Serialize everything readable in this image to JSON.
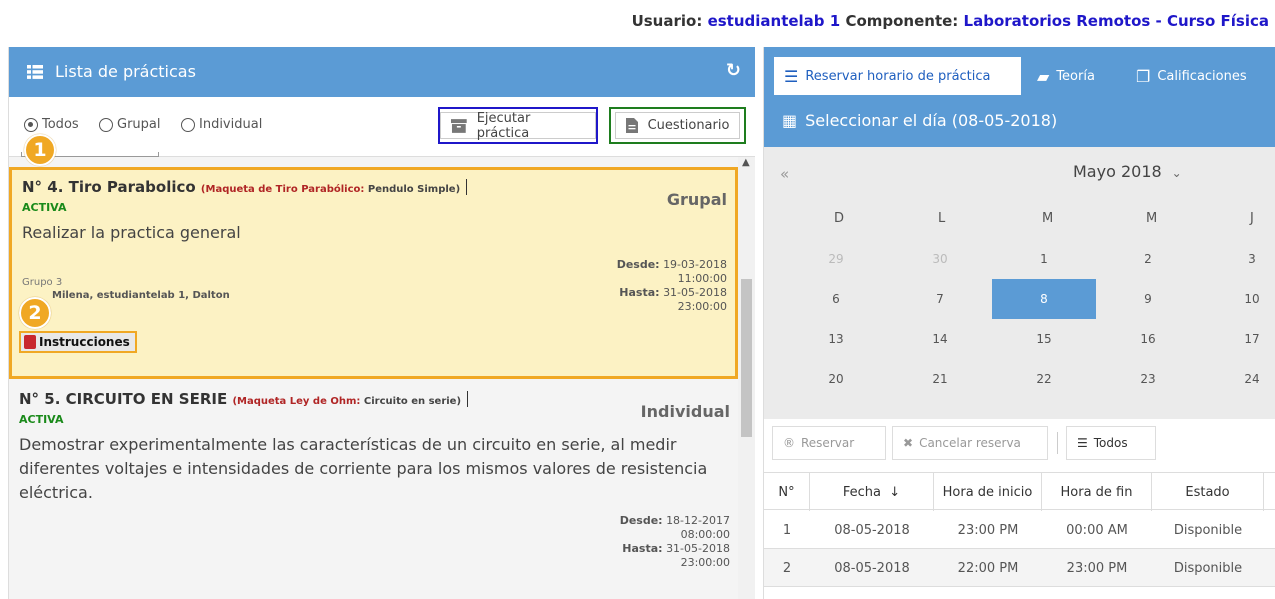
{
  "userbar": {
    "usuario_label": "Usuario:",
    "usuario": "estudiantelab 1",
    "componente_label": "Componente:",
    "componente": "Laboratorios Remotos - Curso Física"
  },
  "left": {
    "title": "Lista de prácticas",
    "filters": [
      "Todos",
      "Grupal",
      "Individual"
    ],
    "selected_filter": "Todos",
    "buttons": {
      "ejecutar": "Ejecutar práctica",
      "cuestionario": "Cuestionario"
    },
    "badges": [
      "1",
      "2"
    ],
    "practices": [
      {
        "name": "N° 4. Tiro Parabolico",
        "maqueta_label": "(Maqueta de Tiro Parabólico:",
        "maqueta_sub": "Pendulo Simple)",
        "estado": "ACTIVA",
        "tipo": "Grupal",
        "desc": "Realizar la practica general",
        "desde_label": "Desde:",
        "desde_date": "19-03-2018",
        "desde_time": "11:00:00",
        "hasta_label": "Hasta:",
        "hasta_date": "31-05-2018",
        "hasta_time": "23:00:00",
        "grupo": "Grupo 3",
        "miembros": "Milena, estudiantelab 1, Dalton",
        "instrucciones": "Instrucciones"
      },
      {
        "name": "N° 5. CIRCUITO EN SERIE",
        "maqueta_label": "(Maqueta Ley de Ohm:",
        "maqueta_sub": "Circuito en serie)",
        "estado": "ACTIVA",
        "tipo": "Individual",
        "desc": "Demostrar experimentalmente las características de un circuito en serie, al medir diferentes voltajes e intensidades de corriente para los mismos valores de resistencia eléctrica.",
        "desde_label": "Desde:",
        "desde_date": "18-12-2017",
        "desde_time": "08:00:00",
        "hasta_label": "Hasta:",
        "hasta_date": "31-05-2018",
        "hasta_time": "23:00:00"
      }
    ]
  },
  "right": {
    "tabs": [
      "Reservar horario de práctica",
      "Teoría",
      "Calificaciones"
    ],
    "select_day": "Seleccionar el día (08-05-2018)",
    "calendar": {
      "prev": "«",
      "month": "Mayo 2018",
      "dow": [
        "D",
        "L",
        "M",
        "M",
        "J"
      ],
      "weeks": [
        [
          "29",
          "30",
          "1",
          "2",
          "3"
        ],
        [
          "6",
          "7",
          "8",
          "9",
          "10"
        ],
        [
          "13",
          "14",
          "15",
          "16",
          "17"
        ],
        [
          "20",
          "21",
          "22",
          "23",
          "24"
        ]
      ],
      "selected": "8"
    },
    "toolbar": {
      "reservar": "Reservar",
      "cancelar": "Cancelar reserva",
      "todos": "Todos"
    },
    "table": {
      "headers": [
        "N°",
        "Fecha",
        "Hora de inicio",
        "Hora de fin",
        "Estado"
      ],
      "rows": [
        [
          "1",
          "08-05-2018",
          "23:00 PM",
          "00:00 AM",
          "Disponible"
        ],
        [
          "2",
          "08-05-2018",
          "22:00 PM",
          "23:00 PM",
          "Disponible"
        ]
      ]
    }
  }
}
